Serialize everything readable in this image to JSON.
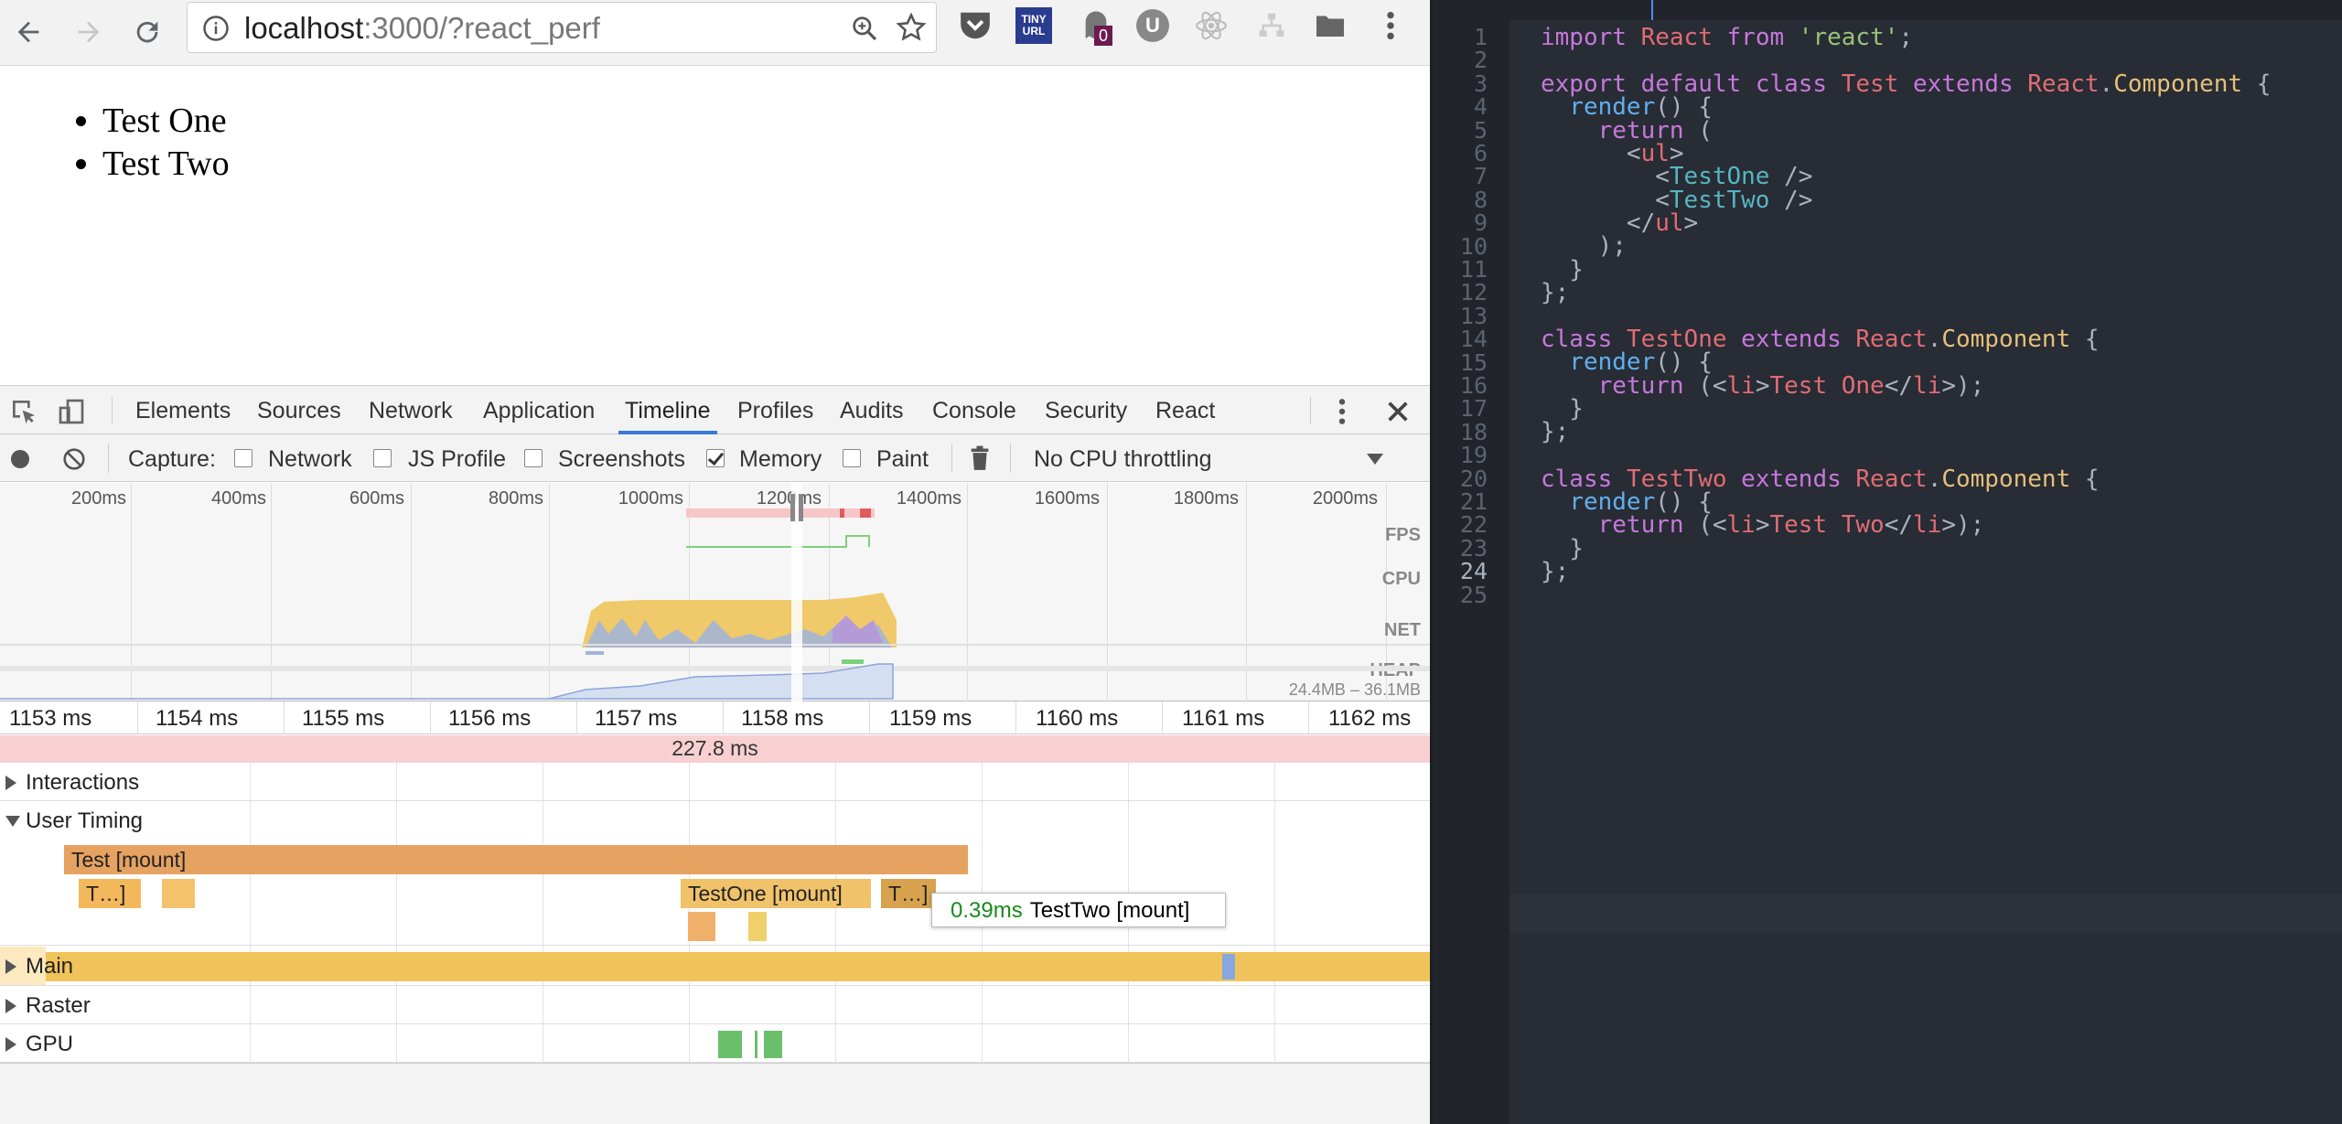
{
  "browser": {
    "url_host": "localhost",
    "url_rest": ":3000/?react_perf",
    "extension_badge": "0",
    "ext_tinyurl_line1": "TINY",
    "ext_tinyurl_line2": "URL",
    "ext_u_label": "U"
  },
  "page": {
    "items": [
      "Test One",
      "Test Two"
    ]
  },
  "devtools": {
    "tabs": [
      "Elements",
      "Sources",
      "Network",
      "Application",
      "Timeline",
      "Profiles",
      "Audits",
      "Console",
      "Security",
      "React"
    ],
    "active_tab": "Timeline",
    "capture": {
      "label": "Capture:",
      "options": [
        {
          "label": "Network",
          "checked": false
        },
        {
          "label": "JS Profile",
          "checked": false
        },
        {
          "label": "Screenshots",
          "checked": false
        },
        {
          "label": "Memory",
          "checked": true
        },
        {
          "label": "Paint",
          "checked": false
        }
      ],
      "throttling": "No CPU throttling"
    },
    "overview": {
      "ticks": [
        "200ms",
        "400ms",
        "600ms",
        "800ms",
        "1000ms",
        "1200ms",
        "1400ms",
        "1600ms",
        "1800ms",
        "2000ms"
      ],
      "labels": [
        "FPS",
        "CPU",
        "NET",
        "HEAP"
      ],
      "heap_range": "24.4MB – 36.1MB"
    },
    "ruler": [
      "1153 ms",
      "1154 ms",
      "1155 ms",
      "1156 ms",
      "1157 ms",
      "1158 ms",
      "1159 ms",
      "1160 ms",
      "1161 ms",
      "1162 ms"
    ],
    "frame_duration": "227.8 ms",
    "tracks": {
      "interactions": "Interactions",
      "user_timing": "User Timing",
      "main": "Main",
      "raster": "Raster",
      "gpu": "GPU"
    },
    "user_timing_bars": {
      "test_mount": "Test [mount]",
      "t1": "T…]",
      "testone_mount": "TestOne [mount]",
      "t2": "T…]"
    },
    "tooltip": {
      "duration": "0.39ms",
      "name": "TestTwo [mount]"
    }
  },
  "editor": {
    "current_line": 24,
    "line_count": 25
  }
}
